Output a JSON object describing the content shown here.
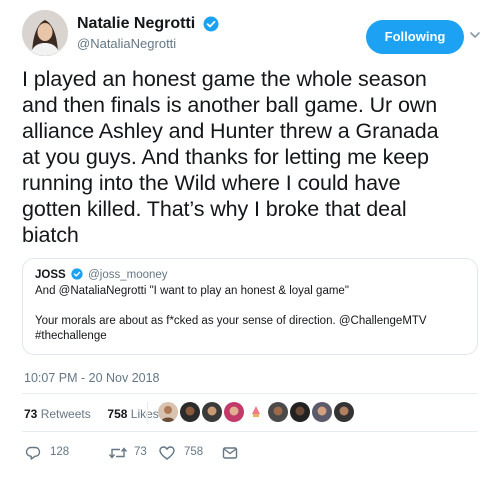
{
  "author": {
    "display_name": "Natalie Negrotti",
    "handle": "@NataliaNegrotti",
    "avatar_icon": "profile-avatar",
    "verified_icon": "verified-badge-icon"
  },
  "follow_button": {
    "label": "Following"
  },
  "tweet": {
    "line1": "I played an honest game the whole season",
    "line2": "and then finals is another ball game. Ur own",
    "line3": "alliance Ashley and Hunter threw a Granada",
    "line4": "at you guys.  And thanks for letting me keep",
    "line5": "running into the Wild where I could have",
    "line6": "gotten killed. That’s why I broke that deal",
    "line7": "biatch"
  },
  "quoted": {
    "name": "JOSS",
    "handle": "@joss_mooney",
    "line1": "And @NataliaNegrotti  \"I want to play an honest & loyal game\"",
    "line2": "Your morals are about as f*cked as your sense of direction. @ChallengeMTV",
    "line3": "#thechallenge"
  },
  "timestamp": "10:07 PM - 20 Nov 2018",
  "stats": {
    "retweets_count": "73",
    "retweets_label": "Retweets",
    "likes_count": "758",
    "likes_label": "Likes"
  },
  "actions": {
    "reply_count": "128",
    "retweet_count": "73",
    "like_count": "758"
  },
  "colors": {
    "accent": "#1da1f2",
    "text": "#14171a",
    "secondary": "#657786",
    "border": "#e1e8ed"
  }
}
